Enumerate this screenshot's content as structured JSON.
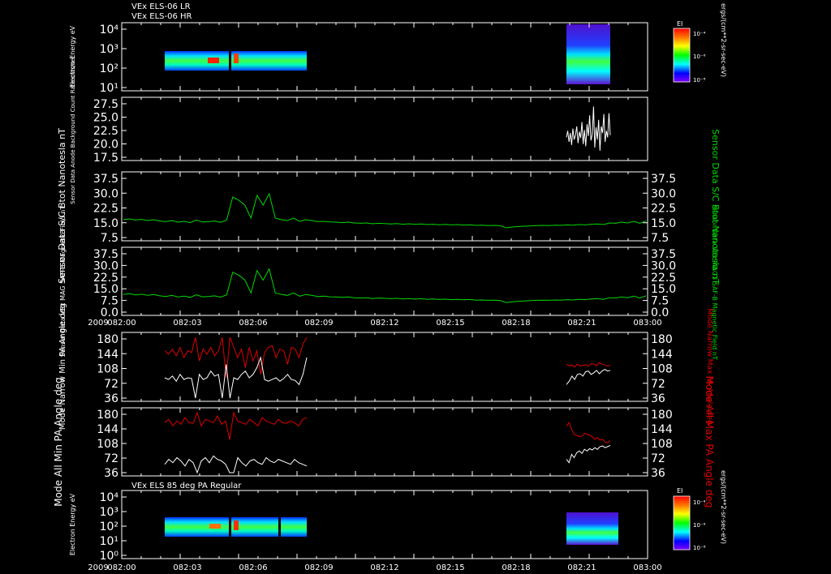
{
  "header": {
    "line1": "VEx ELS-06 LR",
    "line2": "VEx ELS-06 HR",
    "section2": "VEx ELS 85 deg PA Regular"
  },
  "colorbar": {
    "title": "EI",
    "units": "ergs/(cm**2-sr-sec-eV)",
    "ticks": [
      "10⁻⁴",
      "10⁻⁶",
      "10⁻⁸"
    ],
    "colors": [
      "#ff0000",
      "#ff7f00",
      "#ffff00",
      "#00ff00",
      "#00ffff",
      "#0000ff",
      "#7f00ff"
    ]
  },
  "time_axis": {
    "year": "2009",
    "ticks": [
      "082:00",
      "082:03",
      "082:06",
      "082:09",
      "082:12",
      "082:15",
      "082:18",
      "082:21",
      "083:00"
    ]
  },
  "colors": {
    "white": "#ffffff",
    "green": "#00d800",
    "red": "#e00000"
  },
  "chart_data": [
    {
      "id": "els_spectrogram_lr_hr",
      "type": "heatmap",
      "ylabel": "Electron Energy eV",
      "yscale": "log",
      "yticks": [
        "10⁴",
        "10³",
        "10²",
        "10¹"
      ],
      "ylim": [
        1,
        20000
      ],
      "blocks": [
        {
          "x": [
            "082:01",
            "082:08"
          ],
          "y": [
            8,
            150
          ]
        },
        {
          "x": [
            "082:20",
            "082:22"
          ],
          "y": [
            1,
            20000
          ]
        }
      ]
    },
    {
      "id": "anode_background",
      "type": "line",
      "ylabel": "Sensor Data Anode Background Count Rate cnts/sec",
      "yticks": [
        "27.5",
        "25.0",
        "22.5",
        "20.0",
        "17.5"
      ],
      "ylim": [
        15,
        27.5
      ],
      "series": [
        {
          "x_range": [
            "082:20",
            "082:22"
          ],
          "values": [
            19.5,
            21,
            18.5,
            20.5,
            17.8,
            21.5,
            19,
            20,
            22,
            18.2,
            20.8,
            19.4,
            23,
            18,
            21.2,
            17.5,
            22.5,
            19.8,
            24.5,
            18.8,
            20.2,
            26.5,
            17.2,
            21.8,
            19,
            23.5,
            16.5,
            22,
            20.5,
            24.8,
            18.5,
            21,
            19.5,
            25,
            20
          ]
        }
      ]
    },
    {
      "id": "bmag_sc",
      "type": "line",
      "ylabel": "Sensor Data S/C Btot Nanotesla nT",
      "yticks": [
        "37.5",
        "30.0",
        "22.5",
        "15.0",
        "7.5"
      ],
      "ylim": [
        0,
        37.5
      ],
      "series": [
        {
          "color": "green",
          "values": [
            11,
            11.5,
            10.8,
            11.2,
            10.5,
            11,
            10.2,
            9.8,
            10.5,
            9.5,
            10,
            9.2,
            10.8,
            9.6,
            9.8,
            10.2,
            9.4,
            10.8,
            25,
            23,
            20,
            12,
            26,
            20,
            27,
            12,
            11,
            10.5,
            12,
            10,
            11,
            10.5,
            9.8,
            10,
            9.6,
            9.5,
            9.2,
            9.5,
            9,
            8.8,
            9,
            8.5,
            8.8,
            8.6,
            8.4,
            8.6,
            8.2,
            8.5,
            8.1,
            8.4,
            8,
            8.2,
            7.9,
            8.1,
            7.8,
            8,
            7.7,
            7.9,
            7.5,
            7.6,
            7.4,
            7.5,
            7.3,
            6,
            6.5,
            6.8,
            7,
            7.2,
            7.4,
            7.5,
            7.4,
            7.6,
            7.5,
            7.8,
            7.6,
            8,
            7.8,
            8.2,
            8.4,
            8,
            9,
            8.8,
            9.5,
            9,
            10,
            8.8,
            10.2
          ]
        }
      ]
    },
    {
      "id": "bmag_vso",
      "type": "line",
      "ylabel": "Sensor Data VEx MAG SAF-B Magnetic Field nT",
      "ylabel_right": "Sensor Data VEx MAG3 SAF-B Magnetic Field nT",
      "yticks": [
        "37.5",
        "30.0",
        "22.5",
        "15.0",
        "7.5",
        "0.0"
      ],
      "ylim": [
        0,
        37.5
      ],
      "series": [
        {
          "color": "green",
          "values": [
            11,
            11.5,
            10.8,
            11.2,
            10.5,
            11,
            10.2,
            9.8,
            10.5,
            9.5,
            10,
            9.2,
            10.8,
            9.6,
            9.8,
            10.2,
            9.4,
            10.8,
            25,
            23,
            20,
            12,
            26,
            20,
            27,
            12,
            11,
            10.5,
            12,
            10,
            11,
            10.5,
            9.8,
            10,
            9.6,
            9.5,
            9.2,
            9.5,
            9,
            8.8,
            9,
            8.5,
            8.8,
            8.6,
            8.4,
            8.6,
            8.2,
            8.5,
            8.1,
            8.4,
            8,
            8.2,
            7.9,
            8.1,
            7.8,
            8,
            7.7,
            7.9,
            7.5,
            7.6,
            7.4,
            7.5,
            7.3,
            6,
            6.5,
            6.8,
            7,
            7.2,
            7.4,
            7.5,
            7.4,
            7.6,
            7.5,
            7.8,
            7.6,
            8,
            7.8,
            8.2,
            8.4,
            8,
            9,
            8.8,
            9.5,
            9,
            10,
            8.8,
            10.2
          ]
        }
      ]
    },
    {
      "id": "pa_narrow",
      "type": "line",
      "ylabel": "Mode Narrow Min PA Angle deg",
      "ylabel_right": "Mode Narrow Max PA Angle deg",
      "yticks": [
        "180",
        "144",
        "108",
        "72",
        "36"
      ],
      "ylim": [
        0,
        180
      ],
      "series": [
        {
          "name_hidden": "max",
          "color": "red",
          "seg1": [
            140,
            130,
            145,
            125,
            150,
            120,
            140,
            135,
            180,
            110,
            145,
            130,
            150,
            125,
            140,
            180,
            60,
            180,
            150,
            120,
            145,
            90,
            150,
            110,
            140,
            70,
            135,
            150,
            155,
            120,
            145,
            140,
            100,
            150,
            145,
            120,
            160,
            180
          ],
          "seg2": [
            100,
            95,
            98,
            92,
            100,
            95,
            97,
            99,
            94,
            102,
            100,
            96,
            105,
            100,
            98,
            95,
            97
          ]
        },
        {
          "name_hidden": "min",
          "color": "white",
          "seg1": [
            60,
            55,
            65,
            50,
            70,
            55,
            60,
            58,
            0,
            70,
            55,
            60,
            80,
            65,
            70,
            0,
            100,
            0,
            60,
            55,
            70,
            80,
            60,
            70,
            90,
            120,
            55,
            50,
            55,
            60,
            50,
            58,
            70,
            55,
            52,
            40,
            70,
            120
          ],
          "seg2": [
            40,
            50,
            65,
            55,
            70,
            72,
            65,
            78,
            80,
            70,
            75,
            82,
            72,
            80,
            85,
            80,
            82
          ]
        }
      ]
    },
    {
      "id": "pa_all",
      "type": "line",
      "ylabel": "Mode All Min PA Angle deg",
      "ylabel_right": "Mode All Max PA Angle deg",
      "yticks": [
        "180",
        "144",
        "108",
        "72",
        "36"
      ],
      "ylim": [
        0,
        180
      ],
      "series": [
        {
          "color": "red",
          "seg1": [
            150,
            160,
            140,
            155,
            145,
            165,
            150,
            148,
            180,
            140,
            160,
            155,
            150,
            170,
            145,
            155,
            100,
            180,
            155,
            150,
            145,
            160,
            150,
            140,
            165,
            155,
            150,
            145,
            160,
            150,
            148,
            155,
            150,
            140,
            160,
            165
          ],
          "seg2": [
            140,
            150,
            130,
            115,
            112,
            108,
            110,
            118,
            115,
            112,
            108,
            100,
            105,
            98,
            100,
            92,
            90,
            95
          ]
        },
        {
          "color": "white",
          "seg1": [
            25,
            40,
            30,
            45,
            35,
            20,
            40,
            30,
            0,
            35,
            45,
            30,
            50,
            40,
            35,
            25,
            0,
            0,
            45,
            30,
            20,
            35,
            40,
            30,
            25,
            45,
            35,
            30,
            40,
            35,
            30,
            25,
            40,
            30,
            25,
            20
          ],
          "seg2": [
            40,
            30,
            55,
            45,
            60,
            65,
            58,
            70,
            65,
            72,
            68,
            75,
            70,
            78,
            80,
            75,
            78,
            82
          ]
        }
      ]
    },
    {
      "id": "els_spectrogram_85",
      "type": "heatmap",
      "ylabel": "Electron Energy eV",
      "yscale": "log",
      "yticks": [
        "10⁴",
        "10³",
        "10²",
        "10¹",
        "10⁰"
      ],
      "ylim": [
        1,
        20000
      ],
      "blocks": [
        {
          "x": [
            "082:01",
            "082:08"
          ],
          "y": [
            4,
            150
          ]
        },
        {
          "x": [
            "082:20",
            "082:22"
          ],
          "y": [
            1,
            20000
          ]
        }
      ]
    }
  ]
}
